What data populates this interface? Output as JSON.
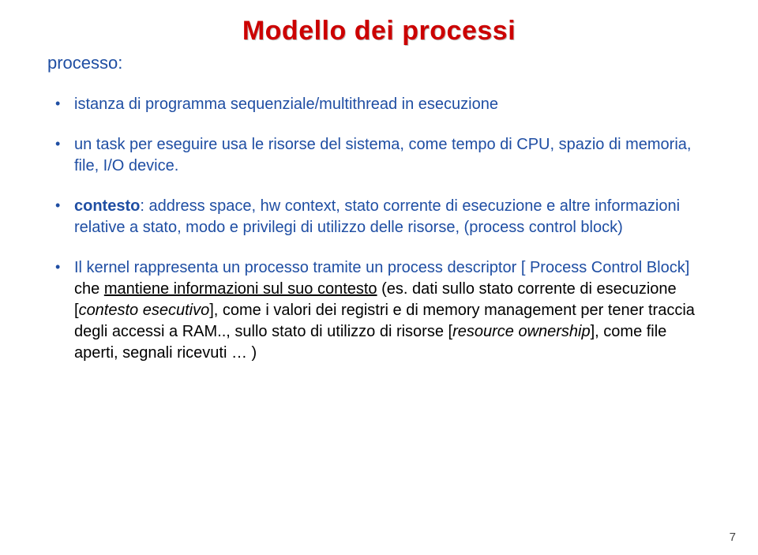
{
  "title": "Modello dei processi",
  "subheading": "processo:",
  "bullets": {
    "b1": "istanza di programma sequenziale/multithread in esecuzione",
    "b2": "un task per eseguire usa le risorse del sistema, come tempo di CPU, spazio di memoria, file, I/O device.",
    "b3": {
      "term": "contesto",
      "rest": ": address space, hw context, stato corrente di esecuzione e altre informazioni relative a stato, modo e privilegi di utilizzo delle risorse, (process control block)"
    },
    "b4": {
      "p1": "Il kernel rappresenta un processo tramite un ",
      "p2": "process descriptor",
      "p3": " [ ",
      "p4": "Process Control Block",
      "p5": "] ",
      "p6_black": "che ",
      "p7_underline": "mantiene informazioni sul suo contesto",
      "p8": " (es. dati sullo stato corrente di esecuzione [",
      "p9_italic": "contesto esecutivo",
      "p10": "], come i valori dei registri e di memory management per tener traccia degli accessi a RAM..,   sullo stato di utilizzo di risorse [",
      "p11_italic": "resource ownership",
      "p12": "], come file aperti, segnali ricevuti … )"
    }
  },
  "page_number": "7"
}
